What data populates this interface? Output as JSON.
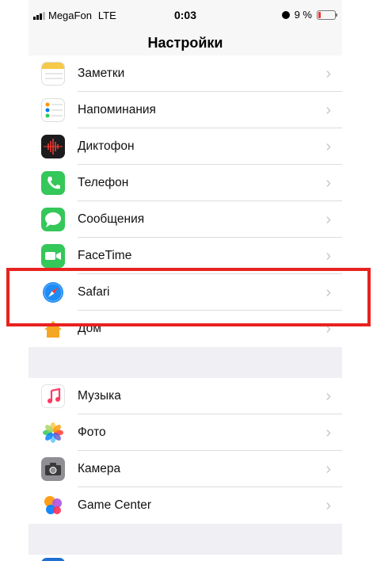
{
  "status": {
    "carrier": "MegaFon",
    "network": "LTE",
    "time": "0:03",
    "battery": "9 %"
  },
  "nav": {
    "title": "Настройки"
  },
  "group1": [
    {
      "label": "Заметки",
      "icon": "notes-icon",
      "color": "#f7c948"
    },
    {
      "label": "Напоминания",
      "icon": "reminders-icon",
      "color": "#ffffff"
    },
    {
      "label": "Диктофон",
      "icon": "voice-memos-icon",
      "color": "#1c1c1e"
    },
    {
      "label": "Телефон",
      "icon": "phone-icon",
      "color": "#34c759"
    },
    {
      "label": "Сообщения",
      "icon": "messages-icon",
      "color": "#34c759"
    },
    {
      "label": "FaceTime",
      "icon": "facetime-icon",
      "color": "#34c759"
    },
    {
      "label": "Safari",
      "icon": "safari-icon",
      "color": "#1f8cf5"
    },
    {
      "label": "Дом",
      "icon": "home-icon",
      "color": "#f5a623"
    }
  ],
  "group2": [
    {
      "label": "Музыка",
      "icon": "music-icon",
      "color": "#ffffff"
    },
    {
      "label": "Фото",
      "icon": "photos-icon",
      "color": "#ffffff"
    },
    {
      "label": "Камера",
      "icon": "camera-icon",
      "color": "#8e8e93"
    },
    {
      "label": "Game Center",
      "icon": "game-center-icon",
      "color": "#ffffff"
    }
  ],
  "chevron": "›",
  "highlight_color": "#e8221f"
}
